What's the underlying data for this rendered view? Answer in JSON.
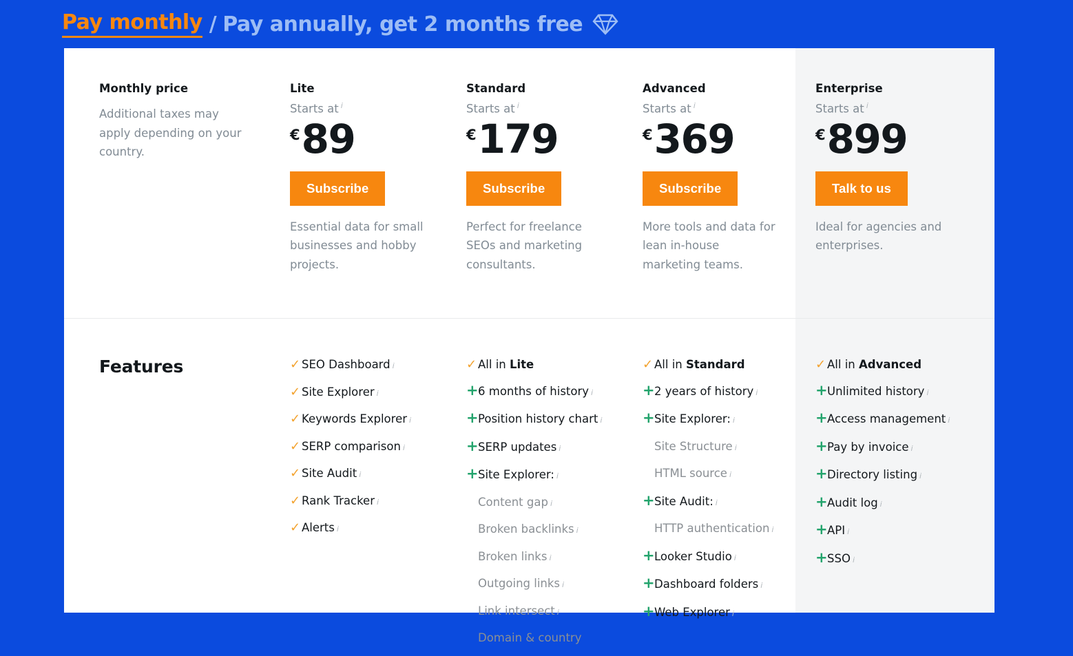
{
  "billing_toggle": {
    "monthly_label": "Pay monthly",
    "separator": "/",
    "annual_label": "Pay annually, get 2 months free",
    "gem_icon": "diamond-icon",
    "active_color": "#f7870f",
    "inactive_color": "#9dbdf5"
  },
  "background_color": "#0b4bde",
  "accent_color": "#f7870f",
  "check_color": "#f3a22d",
  "plus_color": "#24a46d",
  "pricing": {
    "lead": {
      "title": "Monthly price",
      "description": "Additional taxes may apply depending on your country."
    },
    "info_marker": "i",
    "plans": [
      {
        "name": "Lite",
        "starts_at": "Starts at",
        "currency": "€",
        "amount": "89",
        "cta": "Subscribe",
        "description": "Essential data for small businesses and hobby projects."
      },
      {
        "name": "Standard",
        "starts_at": "Starts at",
        "currency": "€",
        "amount": "179",
        "cta": "Subscribe",
        "description": "Perfect for freelance SEOs and marketing consultants."
      },
      {
        "name": "Advanced",
        "starts_at": "Starts at",
        "currency": "€",
        "amount": "369",
        "cta": "Subscribe",
        "description": "More tools and data for lean in-house marketing teams."
      },
      {
        "name": "Enterprise",
        "starts_at": "Starts at",
        "currency": "€",
        "amount": "899",
        "cta": "Talk to us",
        "description": "Ideal for agencies and enterprises."
      }
    ]
  },
  "features": {
    "heading": "Features",
    "columns": [
      {
        "plan": "Lite",
        "items": [
          {
            "marker": "check",
            "label": "SEO Dashboard",
            "info": true
          },
          {
            "marker": "check",
            "label": "Site Explorer",
            "info": true
          },
          {
            "marker": "check",
            "label": "Keywords Explorer",
            "info": true
          },
          {
            "marker": "check",
            "label": "SERP comparison",
            "info": true
          },
          {
            "marker": "check",
            "label": "Site Audit",
            "info": true
          },
          {
            "marker": "check",
            "label": "Rank Tracker",
            "info": true
          },
          {
            "marker": "check",
            "label": "Alerts",
            "info": true
          }
        ]
      },
      {
        "plan": "Standard",
        "items": [
          {
            "marker": "check",
            "label": "All in ",
            "bold": "Lite",
            "info": false
          },
          {
            "marker": "plus",
            "label": "6 months of history",
            "info": true
          },
          {
            "marker": "plus",
            "label": "Position history chart",
            "info": true
          },
          {
            "marker": "plus",
            "label": "SERP updates",
            "info": true
          },
          {
            "marker": "plus",
            "label": "Site Explorer:",
            "info": true
          },
          {
            "marker": "none",
            "sub": true,
            "label": "Content gap",
            "info": true
          },
          {
            "marker": "none",
            "sub": true,
            "label": "Broken backlinks",
            "info": true
          },
          {
            "marker": "none",
            "sub": true,
            "label": "Broken links",
            "info": true
          },
          {
            "marker": "none",
            "sub": true,
            "label": "Outgoing links",
            "info": true
          },
          {
            "marker": "none",
            "sub": true,
            "label": "Link intersect",
            "info": true
          },
          {
            "marker": "none",
            "sub": true,
            "label": "Domain & country",
            "info": false
          }
        ]
      },
      {
        "plan": "Advanced",
        "items": [
          {
            "marker": "check",
            "label": "All in ",
            "bold": "Standard",
            "info": false
          },
          {
            "marker": "plus",
            "label": "2 years of history",
            "info": true
          },
          {
            "marker": "plus",
            "label": "Site Explorer:",
            "info": true
          },
          {
            "marker": "none",
            "sub": true,
            "label": "Site Structure",
            "info": true
          },
          {
            "marker": "none",
            "sub": true,
            "label": "HTML source",
            "info": true
          },
          {
            "marker": "plus",
            "label": "Site Audit:",
            "info": true
          },
          {
            "marker": "none",
            "sub": true,
            "label": "HTTP authentication",
            "info": true
          },
          {
            "marker": "plus",
            "label": "Looker Studio",
            "info": true
          },
          {
            "marker": "plus",
            "label": "Dashboard folders",
            "info": true
          },
          {
            "marker": "plus",
            "label": "Web Explorer",
            "info": true
          }
        ]
      },
      {
        "plan": "Enterprise",
        "items": [
          {
            "marker": "check",
            "label": "All in ",
            "bold": "Advanced",
            "info": false
          },
          {
            "marker": "plus",
            "label": "Unlimited history",
            "info": true
          },
          {
            "marker": "plus",
            "label": "Access management",
            "info": true
          },
          {
            "marker": "plus",
            "label": "Pay by invoice",
            "info": true
          },
          {
            "marker": "plus",
            "label": "Directory listing",
            "info": true
          },
          {
            "marker": "plus",
            "label": "Audit log",
            "info": true
          },
          {
            "marker": "plus",
            "label": "API",
            "info": true
          },
          {
            "marker": "plus",
            "label": "SSO",
            "info": true
          }
        ]
      }
    ]
  }
}
